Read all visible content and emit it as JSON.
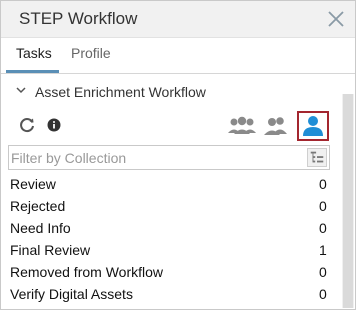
{
  "window": {
    "title": "STEP Workflow"
  },
  "tabs": [
    {
      "label": "Tasks",
      "active": true
    },
    {
      "label": "Profile",
      "active": false
    }
  ],
  "section": {
    "title": "Asset Enrichment Workflow"
  },
  "toolbar": {
    "group_selected": "me"
  },
  "filter": {
    "placeholder": "Filter by Collection",
    "value": ""
  },
  "states": [
    {
      "label": "Review",
      "count": "0"
    },
    {
      "label": "Rejected",
      "count": "0"
    },
    {
      "label": "Need Info",
      "count": "0"
    },
    {
      "label": "Final Review",
      "count": "1"
    },
    {
      "label": "Removed from Workflow",
      "count": "0"
    },
    {
      "label": "Verify Digital Assets",
      "count": "0"
    }
  ],
  "colors": {
    "accent": "#1f8ed6",
    "selected_border": "#a3262f",
    "tab_underline": "#5a8fb6"
  },
  "icons": [
    "close-icon",
    "chevron-down-icon",
    "refresh-icon",
    "info-icon",
    "group-all-icon",
    "group-team-icon",
    "user-icon",
    "tree-view-icon"
  ]
}
